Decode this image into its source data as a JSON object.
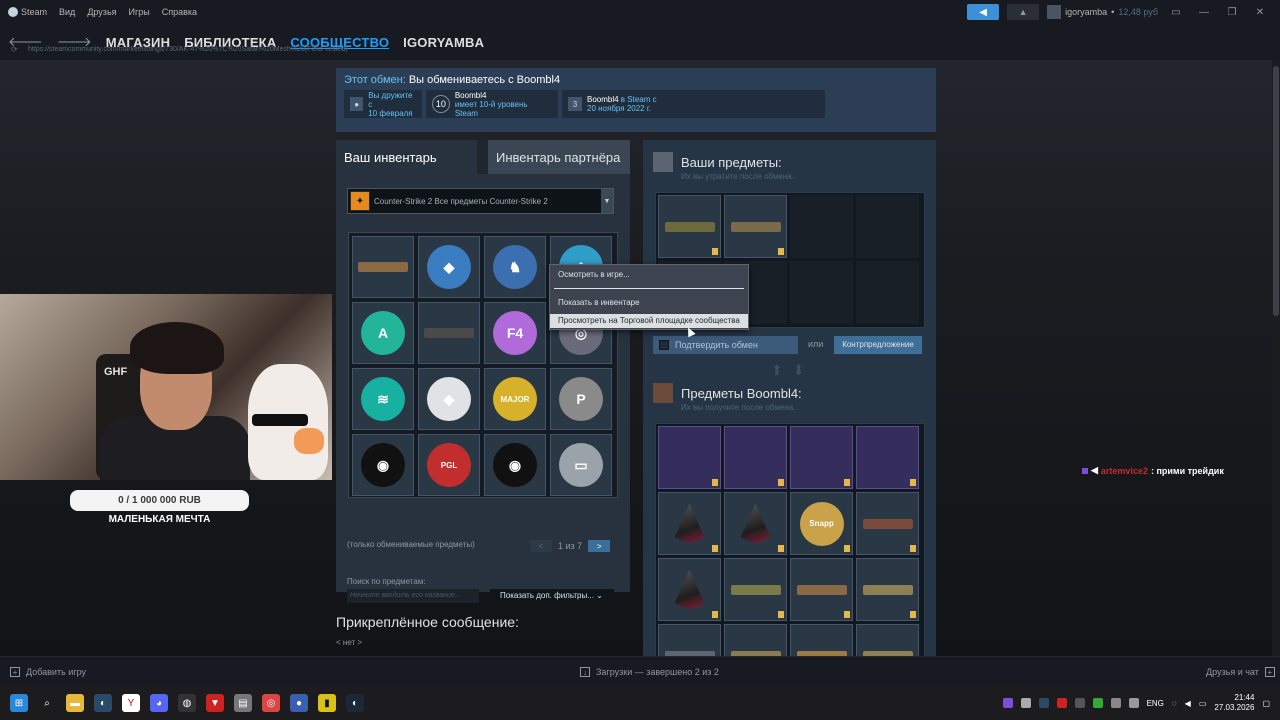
{
  "steam": {
    "app_name": "Steam",
    "menu": [
      "Вид",
      "Друзья",
      "Игры",
      "Справка"
    ],
    "nav": [
      "МАГАЗИН",
      "БИБЛИОТЕКА",
      "СООБЩЕСТВО",
      "IGORYAMBA"
    ],
    "url": "https://steamcommunity.com/market/listings/730/AK-47%20%7C%20Safari%20Mesh%20(Field-Tested)",
    "username": "igoryamba",
    "wallet": "12,48 руб",
    "bottom_add_game": "Добавить игру",
    "bottom_downloads": "Загрузки — завершено 2 из 2",
    "bottom_friends": "Друзья и чат"
  },
  "trade": {
    "label": "Этот обмен:",
    "title": "Вы обмениваетесь с Boombl4",
    "friends_since_l1": "Вы дружите с",
    "friends_since_l2": "10 февраля",
    "level_number": "10",
    "partner_name": "Boombl4",
    "level_text": "имеет 10-й уровень Steam",
    "steam_since_name": "Boombl4",
    "steam_since_suffix": " в Steam с",
    "steam_since_date": "20 ноября 2022 г.",
    "steam_years": "3"
  },
  "inventory": {
    "tab_yours": "Ваш инвентарь",
    "tab_partner": "Инвентарь партнёра",
    "game_select": "Counter-Strike 2 Все предметы Counter-Strike 2",
    "tradable_note": "(только обмениваемые предметы)",
    "page_text": "1 из 7",
    "prev": "<",
    "next": ">",
    "search_label": "Поиск по предметам:",
    "search_placeholder": "Начните вводить его название...",
    "filter_button": "Показать доп. фильтры...",
    "items": [
      {
        "kind": "gun",
        "color": "#8a6a45"
      },
      {
        "kind": "sticker",
        "color": "#3a7dc1",
        "glyph": "◆"
      },
      {
        "kind": "sticker",
        "color": "#3b6fb0",
        "glyph": "♞"
      },
      {
        "kind": "sticker",
        "color": "#2f9ec9",
        "glyph": "A"
      },
      {
        "kind": "sticker",
        "color": "#22b59a",
        "glyph": "A"
      },
      {
        "kind": "gun",
        "color": "#4a4a4a"
      },
      {
        "kind": "sticker",
        "color": "#b06ad9",
        "glyph": "F4"
      },
      {
        "kind": "sticker",
        "color": "#6a6a7a",
        "glyph": "◎"
      },
      {
        "kind": "sticker",
        "color": "#18b0a0",
        "glyph": "≋"
      },
      {
        "kind": "sticker",
        "color": "#dfe3e6",
        "glyph": "◆"
      },
      {
        "kind": "sticker",
        "color": "#d7b12a",
        "glyph": "MAJOR"
      },
      {
        "kind": "sticker",
        "color": "#8a8a8a",
        "glyph": "P"
      },
      {
        "kind": "sticker",
        "color": "#111111",
        "glyph": "◉"
      },
      {
        "kind": "sticker",
        "color": "#c22d2d",
        "glyph": "PGL"
      },
      {
        "kind": "sticker",
        "color": "#111111",
        "glyph": "◉"
      },
      {
        "kind": "sticker",
        "color": "#9aa3aa",
        "glyph": "▭"
      }
    ]
  },
  "context_menu": {
    "inspect": "Осмотреть в игре...",
    "show_inventory": "Показать в инвентаре",
    "view_market": "Просмотреть на Торговой площадке сообщества"
  },
  "your_items": {
    "title": "Ваши предметы:",
    "subtitle": "Их вы утратите после обмена.",
    "confirm": "Подтвердить обмен",
    "or": "или",
    "counter": "Контрпредложение"
  },
  "their_items": {
    "title": "Предметы Boombl4:",
    "subtitle": "Их вы получите после обмена.",
    "items": [
      {
        "kind": "spark-g"
      },
      {
        "kind": "spark-g"
      },
      {
        "kind": "spark-o"
      },
      {
        "kind": "spark-o"
      },
      {
        "kind": "case",
        "color": "#8b1f35"
      },
      {
        "kind": "case",
        "color": "#8b1f35"
      },
      {
        "kind": "sticker",
        "color": "#c9a24a",
        "glyph": "Snapp"
      },
      {
        "kind": "gun",
        "color": "#7a4a3a"
      },
      {
        "kind": "case",
        "color": "#8b1f35"
      },
      {
        "kind": "gun",
        "color": "#7b7b4a"
      },
      {
        "kind": "gun",
        "color": "#8a6a45"
      },
      {
        "kind": "gun",
        "color": "#8d8055"
      },
      {
        "kind": "gun",
        "color": "#5c6670"
      },
      {
        "kind": "gun",
        "color": "#8a7a55"
      },
      {
        "kind": "gun",
        "color": "#9a7a45"
      },
      {
        "kind": "gun",
        "color": "#8d8055"
      }
    ]
  },
  "pinned": {
    "title": "Прикреплённое сообщение:",
    "none": "< нет >"
  },
  "stream": {
    "chair_logo": "GHF",
    "donation": "0 / 1 000 000 RUB",
    "donation_label": "МАЛЕНЬКАЯ МЕЧТА",
    "chat_user": "artemvice2",
    "chat_text": " : прими трейдик"
  },
  "taskbar": {
    "lang": "ENG",
    "time": "21:44",
    "date": "27.03.2026"
  }
}
